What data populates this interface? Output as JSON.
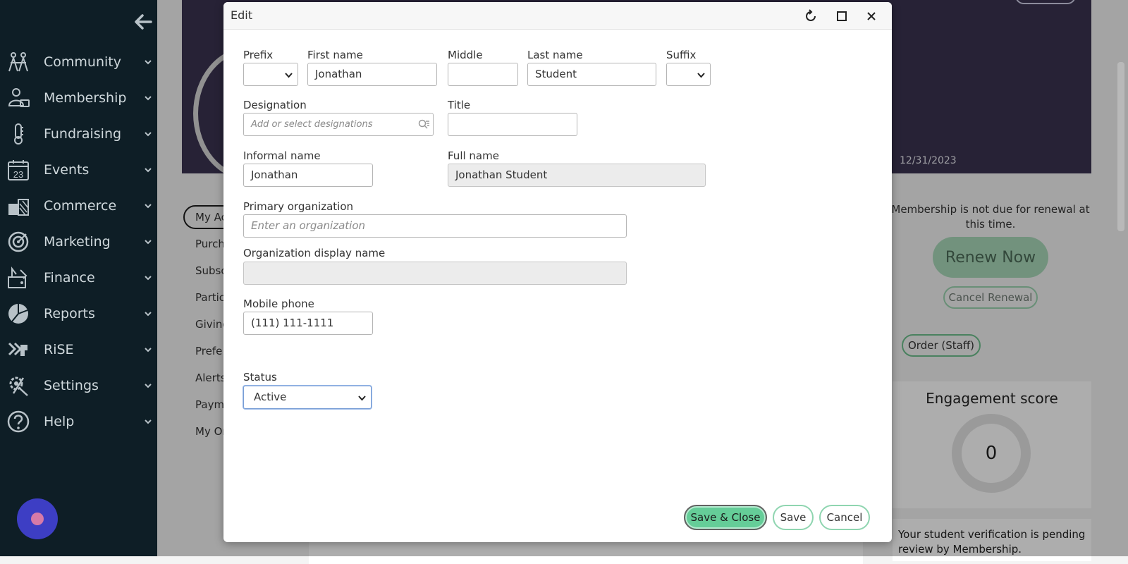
{
  "sidebar": {
    "items": [
      {
        "label": "Community",
        "icon": "community-icon"
      },
      {
        "label": "Membership",
        "icon": "membership-icon"
      },
      {
        "label": "Fundraising",
        "icon": "fundraising-icon"
      },
      {
        "label": "Events",
        "icon": "calendar-icon",
        "icon_text": "23"
      },
      {
        "label": "Commerce",
        "icon": "commerce-icon"
      },
      {
        "label": "Marketing",
        "icon": "marketing-icon"
      },
      {
        "label": "Finance",
        "icon": "finance-icon"
      },
      {
        "label": "Reports",
        "icon": "reports-icon"
      },
      {
        "label": "RiSE",
        "icon": "rise-icon"
      },
      {
        "label": "Settings",
        "icon": "settings-icon"
      },
      {
        "label": "Help",
        "icon": "help-icon"
      }
    ]
  },
  "background": {
    "banner_date": "12/31/2023",
    "submenu": [
      "My Ac",
      "Purch",
      "Subsc",
      "Partic",
      "Giving",
      "Prefe",
      "Alerts",
      "Paym",
      "My Or"
    ],
    "renew_text": "Membership is not due for renewal at this time.",
    "renew_button": "Renew Now",
    "cancel_renewal": "Cancel Renewal",
    "order_staff": "Order (Staff)",
    "engagement_title": "Engagement score",
    "engagement_value": "0",
    "notice": "Your student verification is pending review by Membership."
  },
  "modal": {
    "title": "Edit",
    "fields": {
      "prefix": {
        "label": "Prefix",
        "value": ""
      },
      "first_name": {
        "label": "First name",
        "value": "Jonathan"
      },
      "middle": {
        "label": "Middle",
        "value": ""
      },
      "last_name": {
        "label": "Last name",
        "value": "Student"
      },
      "suffix": {
        "label": "Suffix",
        "value": ""
      },
      "designation": {
        "label": "Designation",
        "placeholder": "Add or select designations"
      },
      "title": {
        "label": "Title",
        "value": ""
      },
      "informal_name": {
        "label": "Informal name",
        "value": "Jonathan"
      },
      "full_name": {
        "label": "Full name",
        "value": "Jonathan Student"
      },
      "primary_org": {
        "label": "Primary organization",
        "placeholder": "Enter an organization"
      },
      "org_display_name": {
        "label": "Organization display name",
        "value": ""
      },
      "mobile_phone": {
        "label": "Mobile phone",
        "value": "(111) 111-1111"
      },
      "status": {
        "label": "Status",
        "value": "Active"
      }
    },
    "buttons": {
      "save_close": "Save & Close",
      "save": "Save",
      "cancel": "Cancel"
    }
  },
  "colors": {
    "sidebar_bg": "#0e1e26",
    "banner_bg": "#3a3350",
    "primary_button": "#65cd98",
    "accent_green": "#8fd5b0"
  }
}
